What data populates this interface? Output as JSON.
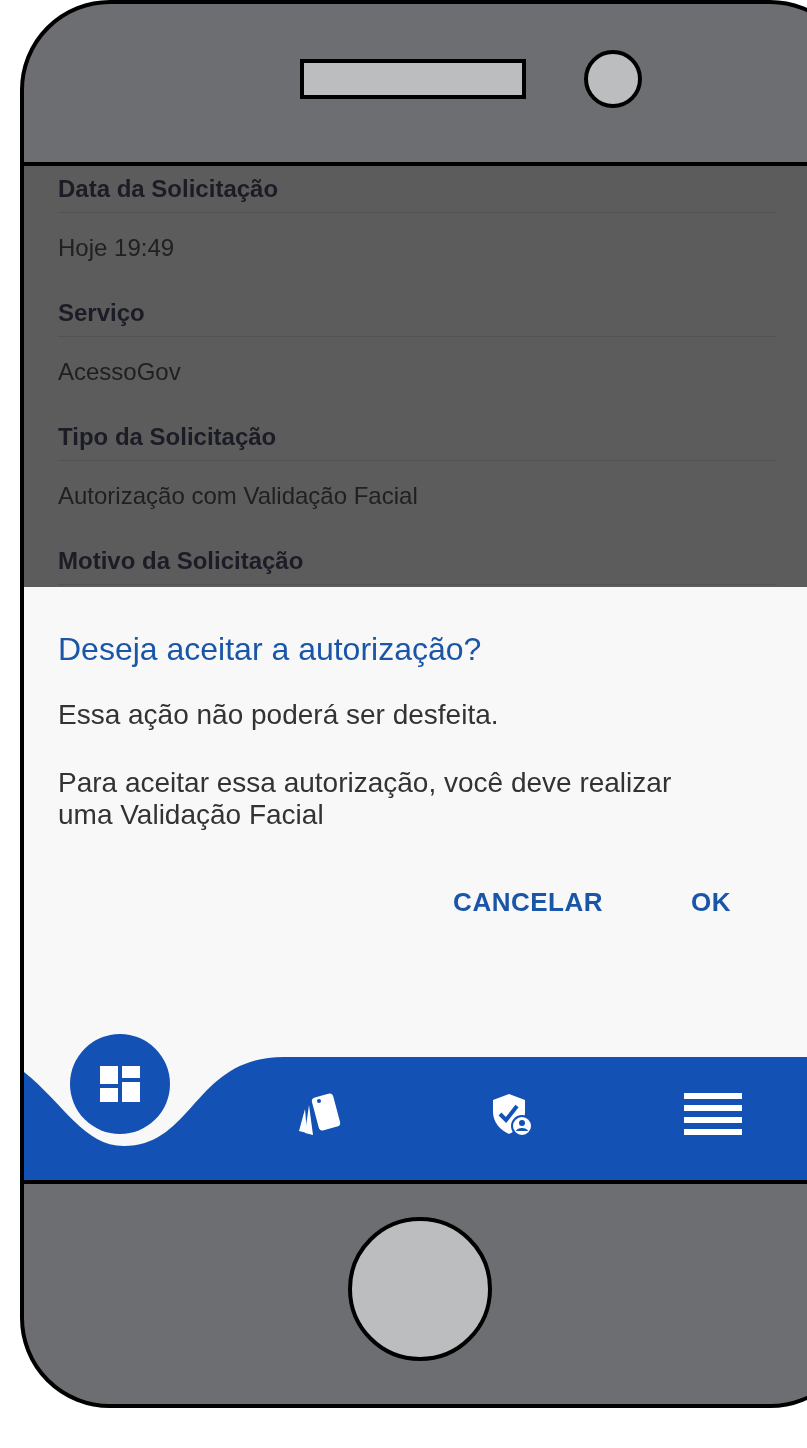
{
  "details": [
    {
      "label": "Data da Solicitação",
      "value": "Hoje 19:49"
    },
    {
      "label": "Serviço",
      "value": "AcessoGov"
    },
    {
      "label": "Tipo da Solicitação",
      "value": "Autorização com Validação Facial"
    },
    {
      "label": "Motivo da Solicitação"
    }
  ],
  "dialog": {
    "title": "Deseja aceitar a autorização?",
    "messages": [
      "Essa ação não poderá ser desfeita.",
      "Para aceitar essa autorização, você deve realizar uma Validação Facial"
    ],
    "actions": [
      "CANCELAR",
      "OK"
    ]
  },
  "nav_items": [
    {
      "selected": true
    },
    {
      "selected": false
    },
    {
      "selected": false
    },
    {
      "selected": false
    }
  ]
}
